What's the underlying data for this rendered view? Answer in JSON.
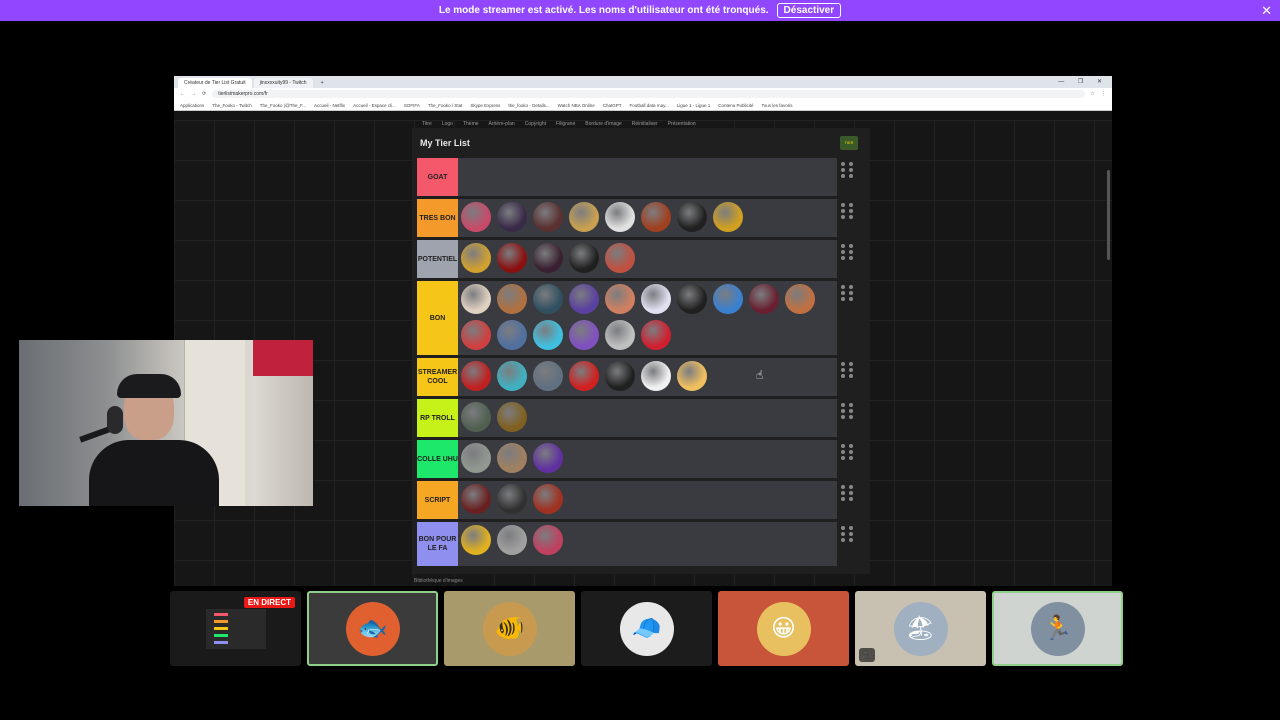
{
  "notice": {
    "message": "Le mode streamer est activé. Les noms d'utilisateur ont été tronqués.",
    "button_label": "Désactiver",
    "close_glyph": "✕"
  },
  "browser": {
    "tabs": [
      {
        "label": "Créateur de Tier List Gratuit"
      },
      {
        "label": "jinxxxxuity99 - Twitch"
      }
    ],
    "new_tab": "+",
    "window_controls": "— ❐ ✕",
    "url": "tierlistmakerpro.com/fr",
    "bookmarks": [
      "Applications",
      "The_Fooko - Twitch",
      "The_Fooko (@The_F...",
      "Accueil - Netflix",
      "Accueil - Espace cli...",
      "SOFIFA",
      "The_Fooko / Stat",
      "Skype Express",
      "the_fooko - Details...",
      "Watch NBA Online",
      "ChatGPT",
      "Football data may...",
      "Ligue 1 - Ligue 1",
      "Contenu Publicité",
      "Tous les favoris"
    ]
  },
  "tierlist": {
    "toolbar": [
      "Titre",
      "Logo",
      "Thème",
      "Arrière-plan",
      "Copyright",
      "Filigrane",
      "Bordure d'image",
      "Réinitialiser",
      "Présentation"
    ],
    "title": "My Tier List",
    "logo_text": "TIER",
    "bottom_text": "Bibliothèque d'images",
    "rows": [
      {
        "label": "GOAT",
        "color": "#f4596b",
        "items": []
      },
      {
        "label": "TRES BON",
        "color": "#f39a2b",
        "items": [
          "#c84a6a",
          "#3a2a4a",
          "#5a3030",
          "#c8a050",
          "#e0e0e0",
          "#a04020",
          "#202020",
          "#d0a020"
        ]
      },
      {
        "label": "POTENTIEL",
        "color": "#9fa3ad",
        "items": [
          "#d0a030",
          "#8a1010",
          "#3a2030",
          "#202020",
          "#c05040"
        ]
      },
      {
        "label": "BON",
        "color": "#f5c518",
        "items": [
          "#e0d0c0",
          "#b07040",
          "#305060",
          "#5a40a0",
          "#d08060",
          "#e0e0f0",
          "#202020",
          "#3a80d0",
          "#6a2030",
          "#c07040",
          "#d04040",
          "#5070a0",
          "#40c0e0",
          "#8050c0",
          "#c0c0c0",
          "#d02030"
        ]
      },
      {
        "label": "STREAMER COOL",
        "color": "#f5c518",
        "items": [
          "#c02020",
          "#40b0c0",
          "#607080",
          "#d02020",
          "#202020",
          "#f0f0f0",
          "#f0c060"
        ]
      },
      {
        "label": "RP TROLL",
        "color": "#c6f21a",
        "items": [
          "#506050",
          "#806020"
        ]
      },
      {
        "label": "COLLE UHU",
        "color": "#1ee86a",
        "items": [
          "#909890",
          "#a08060",
          "#6030a0"
        ]
      },
      {
        "label": "SCRIPT",
        "color": "#f5a623",
        "items": [
          "#6a2020",
          "#303030",
          "#a03020"
        ]
      },
      {
        "label": "BON POUR LE FA",
        "color": "#8f8ff0",
        "items": [
          "#e0b020",
          "#a0a0a0",
          "#c04060"
        ]
      }
    ]
  },
  "participants": [
    {
      "id": "screen-share",
      "live_label": "EN DIRECT",
      "bg": "#1a1a1a"
    },
    {
      "id": "fish-red",
      "bg": "#3b3b3b",
      "avatar_color": "#e06030",
      "glyph": "🐟"
    },
    {
      "id": "goldfish",
      "bg": "#a89a6a",
      "avatar_color": "#c89a50",
      "glyph": "🐠"
    },
    {
      "id": "hooded",
      "bg": "#1c1c1c",
      "avatar_color": "#e8e8e8",
      "glyph": "🧢"
    },
    {
      "id": "bearded",
      "bg": "#c8553a",
      "avatar_color": "#e8c060",
      "glyph": "😀"
    },
    {
      "id": "beach",
      "bg": "#c8c0b0",
      "avatar_color": "#a0b0c0",
      "glyph": "🏖",
      "muted_icon": "🎥"
    },
    {
      "id": "runner",
      "bg": "#d0d4d0",
      "avatar_color": "#8090a0",
      "glyph": "🏃"
    }
  ]
}
